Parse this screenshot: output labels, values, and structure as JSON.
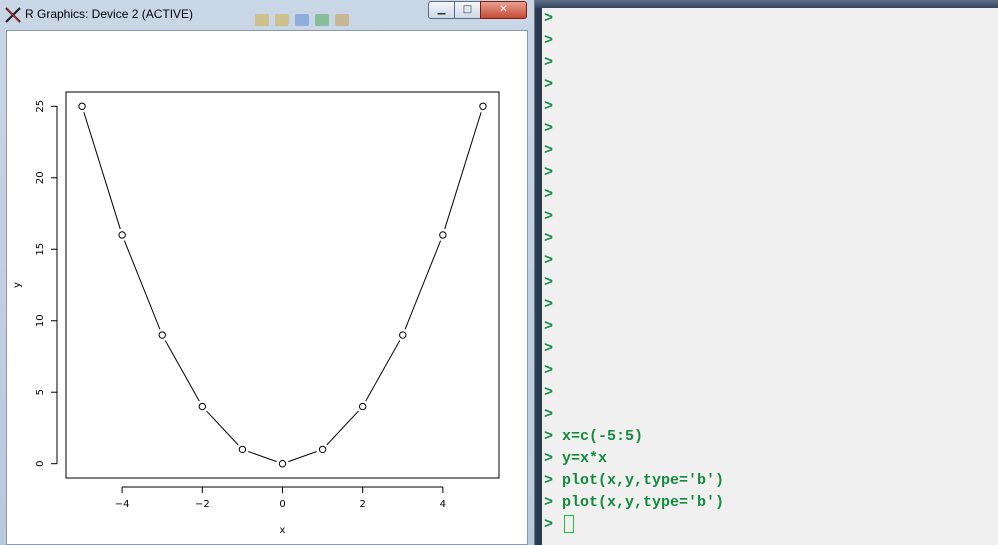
{
  "graphics_window": {
    "title": "R Graphics: Device 2 (ACTIVE)",
    "buttons": {
      "minimize": "▁",
      "maximize": "□",
      "close": "✕"
    }
  },
  "chart_data": {
    "type": "line",
    "title": "",
    "xlabel": "x",
    "ylabel": "y",
    "x": [
      -5,
      -4,
      -3,
      -2,
      -1,
      0,
      1,
      2,
      3,
      4,
      5
    ],
    "series": [
      {
        "values": [
          25,
          16,
          9,
          4,
          1,
          0,
          1,
          4,
          9,
          16,
          25
        ]
      }
    ],
    "xticks": [
      -4,
      -2,
      0,
      2,
      4
    ],
    "yticks": [
      0,
      5,
      10,
      15,
      20,
      25
    ],
    "xlim": [
      -5.4,
      5.4
    ],
    "ylim": [
      -1,
      26
    ],
    "marker": "open-circle",
    "grid": false
  },
  "console": {
    "prompt": ">",
    "empty_prompts": 19,
    "commands": [
      "x=c(-5:5)",
      "y=x*x",
      "plot(x,y,type='b')",
      "plot(x,y,type='b')"
    ]
  },
  "colors": {
    "console_text": "#138a3c",
    "cursor": "#22c034"
  }
}
